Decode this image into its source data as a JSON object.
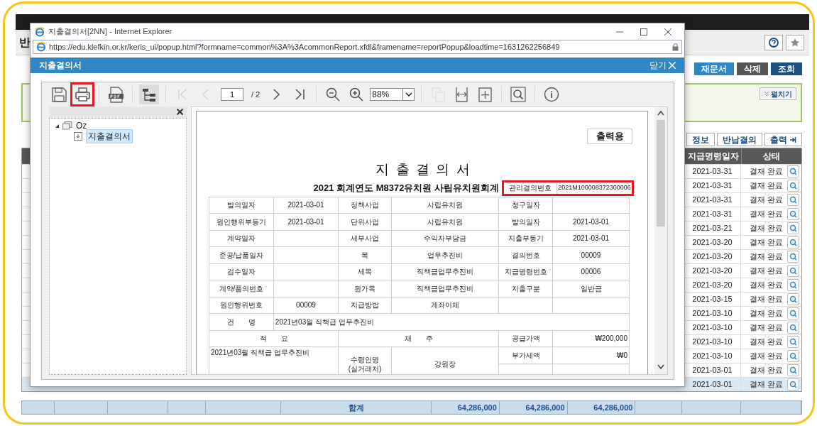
{
  "app": {
    "page_title": "반",
    "buttons": [
      {
        "label": "재문서",
        "kind": "blue"
      },
      {
        "label": "삭제",
        "kind": "gray"
      },
      {
        "label": "조회",
        "kind": "navy"
      }
    ],
    "search_panel": {
      "expand_button": "펼치기"
    },
    "grid_buttons": [
      {
        "label": "정보",
        "kind": "plain"
      },
      {
        "label": "반납결의",
        "kind": "plain"
      },
      {
        "label": "출력",
        "kind": "export"
      }
    ],
    "grid": {
      "columns": [
        "지급명령일자",
        "상태"
      ],
      "rows": [
        {
          "date": "2021-03-31",
          "status": "결재 완료",
          "selected": false
        },
        {
          "date": "2021-03-31",
          "status": "결재 완료",
          "selected": false
        },
        {
          "date": "2021-03-31",
          "status": "결재 완료",
          "selected": false
        },
        {
          "date": "2021-03-31",
          "status": "결재 완료",
          "selected": false
        },
        {
          "date": "2021-03-21",
          "status": "결재 완료",
          "selected": false
        },
        {
          "date": "2021-03-20",
          "status": "결재 완료",
          "selected": false
        },
        {
          "date": "2021-03-20",
          "status": "결재 완료",
          "selected": false
        },
        {
          "date": "2021-03-20",
          "status": "결재 완료",
          "selected": false
        },
        {
          "date": "2021-03-20",
          "status": "결재 완료",
          "selected": false
        },
        {
          "date": "2021-03-15",
          "status": "결재 완료",
          "selected": false
        },
        {
          "date": "2021-03-10",
          "status": "결재 완료",
          "selected": false
        },
        {
          "date": "2021-03-10",
          "status": "결재 완료",
          "selected": false
        },
        {
          "date": "2021-03-10",
          "status": "결재 완료",
          "selected": false
        },
        {
          "date": "2021-03-10",
          "status": "결재 완료",
          "selected": false
        },
        {
          "date": "2021-03-01",
          "status": "결재 완료",
          "selected": false
        },
        {
          "date": "2021-03-01",
          "status": "결재 완료",
          "selected": true
        }
      ]
    },
    "totals": {
      "label": "합계",
      "values": [
        "64,286,000",
        "64,286,000",
        "64,286,000"
      ]
    }
  },
  "popup": {
    "title": "지출결의서[2NN] - Internet Explorer",
    "url": "https://edu.klefkin.or.kr/keris_ui/popup.html?formname=common%3A%3AcommonReport.xfdl&framename=reportPopup&loadtime=1631262256849",
    "header": "지출결의서",
    "close_label": "닫기",
    "toolbar": [
      {
        "kind": "save",
        "disabled": false,
        "active": false,
        "highlighted": false
      },
      {
        "kind": "print",
        "disabled": false,
        "active": false,
        "highlighted": true
      },
      {
        "kind": "separator"
      },
      {
        "kind": "pdf",
        "disabled": false,
        "active": false,
        "highlighted": false
      },
      {
        "kind": "separator"
      },
      {
        "kind": "tree",
        "disabled": false,
        "active": true,
        "highlighted": false
      },
      {
        "kind": "separator"
      },
      {
        "kind": "first",
        "disabled": true,
        "active": false,
        "highlighted": false
      },
      {
        "kind": "prev",
        "disabled": true,
        "active": false,
        "highlighted": false
      },
      {
        "kind": "page",
        "value": "1",
        "total": "/ 2"
      },
      {
        "kind": "next",
        "disabled": false,
        "active": false,
        "highlighted": false
      },
      {
        "kind": "last",
        "disabled": false,
        "active": false,
        "highlighted": false
      },
      {
        "kind": "separator"
      },
      {
        "kind": "zoomout",
        "disabled": false,
        "active": false,
        "highlighted": false
      },
      {
        "kind": "zoomin",
        "disabled": false,
        "active": false,
        "highlighted": false
      },
      {
        "kind": "zoom",
        "value": "88%"
      },
      {
        "kind": "separator"
      },
      {
        "kind": "copy",
        "disabled": true,
        "active": false,
        "highlighted": false
      },
      {
        "kind": "fitwidth",
        "disabled": false,
        "active": false,
        "highlighted": false
      },
      {
        "kind": "fitpage",
        "disabled": false,
        "active": false,
        "highlighted": false
      },
      {
        "kind": "separator"
      },
      {
        "kind": "search",
        "disabled": false,
        "active": false,
        "highlighted": false
      },
      {
        "kind": "separator"
      },
      {
        "kind": "info",
        "disabled": false,
        "active": false,
        "highlighted": false
      }
    ],
    "tree": [
      {
        "label": "Oz",
        "expanded": true,
        "selected": false,
        "children": [
          {
            "label": "지출결의서",
            "selected": true
          }
        ]
      }
    ],
    "document": {
      "stamp": "출력용",
      "title": "지 출 결 의 서",
      "subtitle": "2021 회계연도 M8372유치원 사립유치원회계",
      "number": {
        "label": "관리결의번호",
        "value": "2021M100008372300006",
        "highlighted": true
      },
      "rows": [
        {
          "kind": "pairs",
          "cells": [
            "발의일자",
            "2021-03-01",
            "정책사업",
            "사립유치원",
            "청구일자",
            ""
          ]
        },
        {
          "kind": "pairs",
          "cells": [
            "원인행위부등기",
            "2021-03-01",
            "단위사업",
            "사립유치원",
            "발의일자",
            "2021-03-01"
          ]
        },
        {
          "kind": "pairs",
          "cells": [
            "계약일자",
            "",
            "세부사업",
            "수익자부담금",
            "지출부등기",
            "2021-03-01"
          ]
        },
        {
          "kind": "pairs",
          "cells": [
            "준공/납품일자",
            "",
            "목",
            "업무추진비",
            "결의번호",
            "00009"
          ]
        },
        {
          "kind": "pairs",
          "cells": [
            "검수일자",
            "",
            "세목",
            "직책급업무추진비",
            "지급명령번호",
            "00006"
          ]
        },
        {
          "kind": "pairs",
          "cells": [
            "계약/품의번호",
            "",
            "원가목",
            "직책급업무추진비",
            "지출구분",
            "일반금"
          ]
        },
        {
          "kind": "pairs",
          "cells": [
            "원인행위번호",
            "00009",
            "지급방법",
            "계좌이체",
            "",
            ""
          ]
        },
        {
          "kind": "subject",
          "cells": [
            "건　　명",
            "2021년03월 직책급 업무추진비"
          ]
        },
        {
          "kind": "header",
          "cells": [
            "적　　요",
            "",
            "채　　주",
            "",
            "공급가액",
            "₩200,000"
          ]
        },
        {
          "kind": "detail",
          "cells": [
            "2021년03월 직책급 업무추진비",
            "",
            "수령인명 (실거래처)",
            "강원장",
            "부가세액",
            "₩0"
          ]
        }
      ]
    }
  }
}
